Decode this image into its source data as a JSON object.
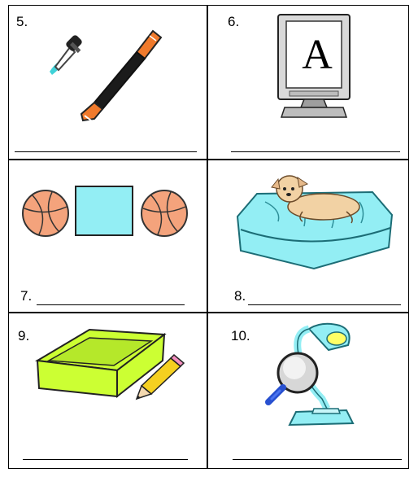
{
  "cells": [
    {
      "number": "5.",
      "icons": [
        "eyedropper-icon",
        "marker-pen-icon"
      ]
    },
    {
      "number": "6.",
      "icons": [
        "monitor-icon"
      ],
      "screen_letter": "A"
    },
    {
      "number": "7.",
      "icons": [
        "basketball-icon",
        "square-icon",
        "basketball-icon"
      ]
    },
    {
      "number": "8.",
      "icons": [
        "dog-on-bed-icon"
      ]
    },
    {
      "number": "9.",
      "icons": [
        "green-box-icon",
        "pencil-icon"
      ]
    },
    {
      "number": "10.",
      "icons": [
        "desk-lamp-icon",
        "magnifier-icon"
      ]
    }
  ],
  "colors": {
    "cyan": "#93eef4",
    "lime": "#ccff33",
    "ball": "#f4a37c",
    "orange": "#f07a2c",
    "pink": "#f58fc0"
  }
}
